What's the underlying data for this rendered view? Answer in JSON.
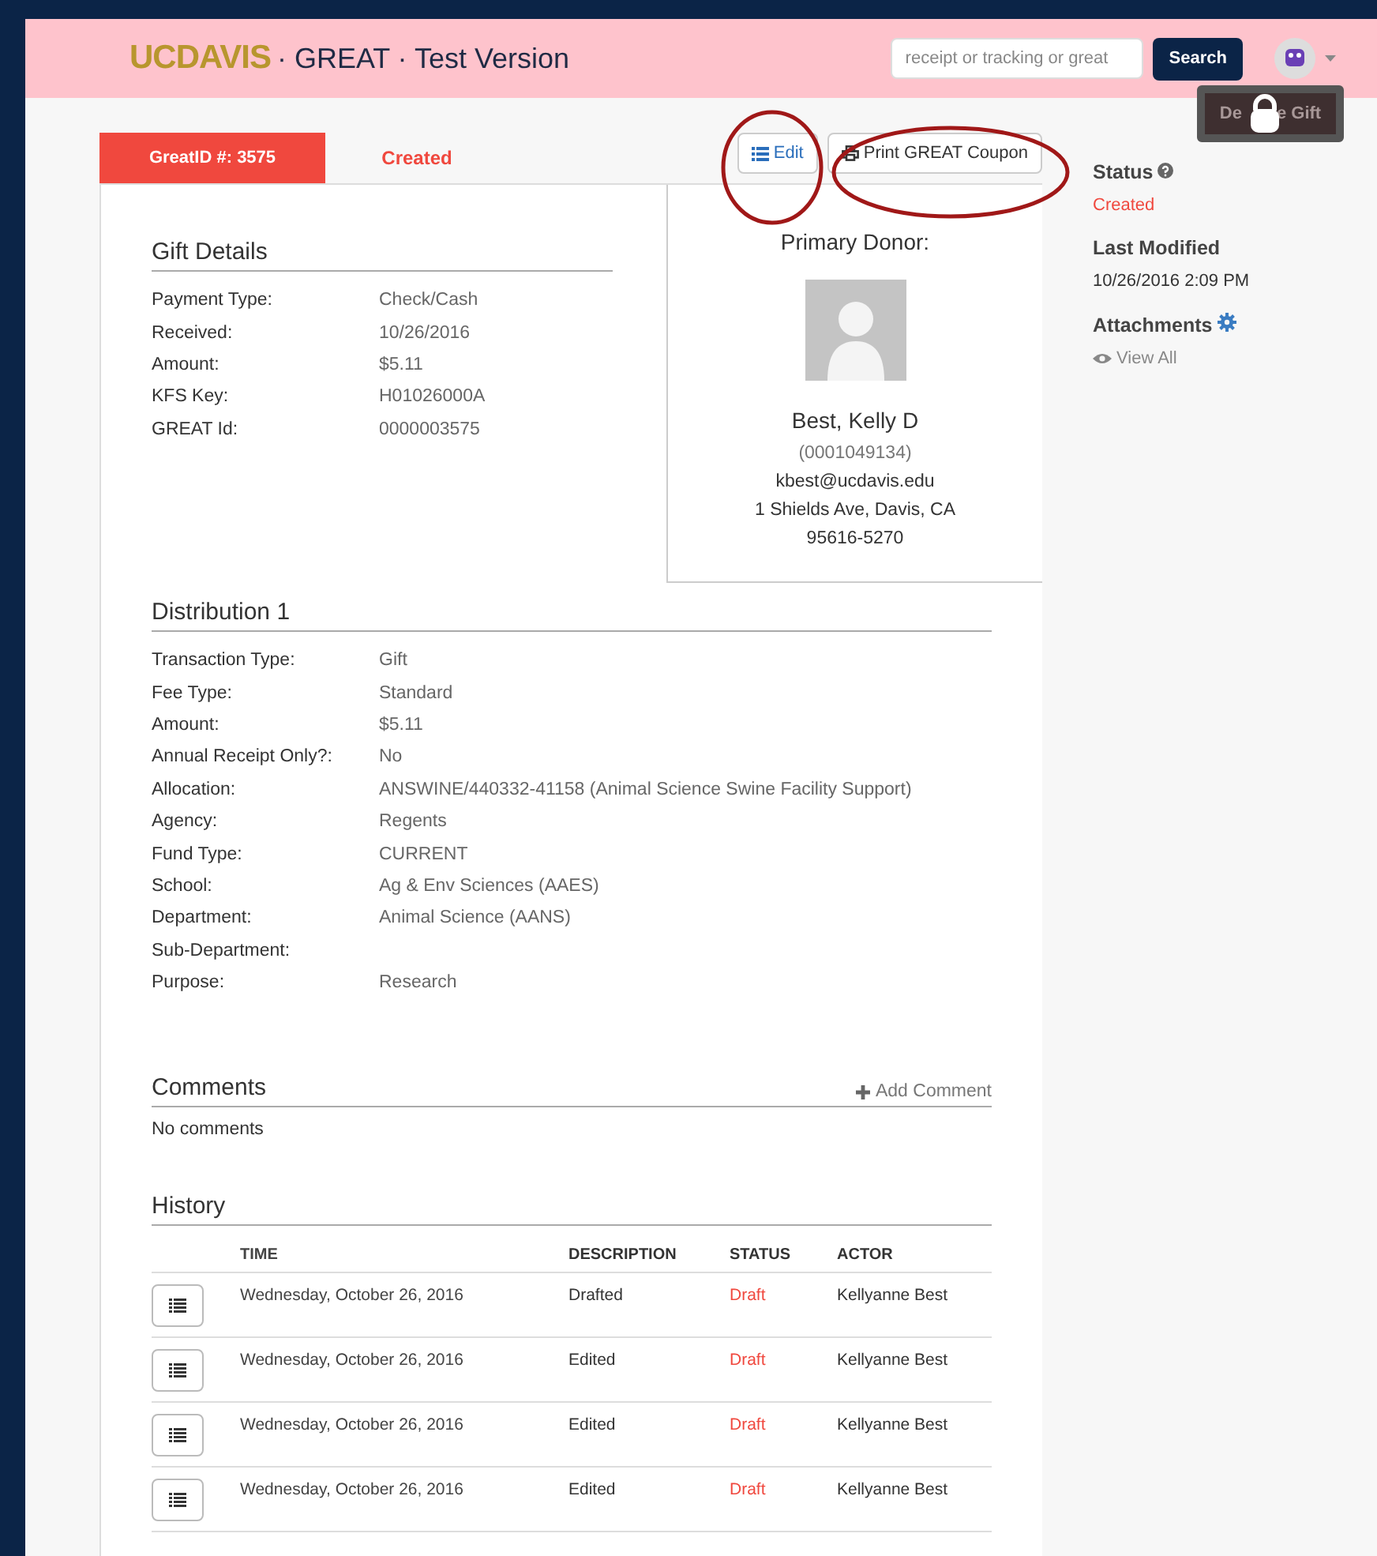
{
  "header": {
    "logo_uc": "UC",
    "logo_davis": "DAVIS",
    "title": "· GREAT · Test Version",
    "search": {
      "placeholder": "receipt or tracking or great"
    },
    "search_button": "Search"
  },
  "tabs": [
    {
      "label": "GreatID #: 3575",
      "selected": true
    },
    {
      "label": "Created",
      "selected": false
    }
  ],
  "actions": [
    {
      "kind": "edit",
      "label": "Edit"
    },
    {
      "kind": "print",
      "label": "Print GREAT Coupon"
    }
  ],
  "gift_details": {
    "title": "Gift Details",
    "fields": [
      {
        "label": "Payment Type:",
        "value": "Check/Cash"
      },
      {
        "label": "Received:",
        "value": "10/26/2016"
      },
      {
        "label": "Amount:",
        "value": "$5.11"
      },
      {
        "label": "KFS Key:",
        "value": "H01026000A"
      },
      {
        "label": "GREAT Id:",
        "value": "0000003575"
      }
    ]
  },
  "donor": {
    "title": "Primary Donor:",
    "name": "Best, Kelly D",
    "id": "(0001049134)",
    "email": "kbest@ucdavis.edu",
    "address": "1 Shields Ave, Davis, CA",
    "zip": "95616-5270"
  },
  "distribution": {
    "title": "Distribution 1",
    "fields": [
      {
        "label": "Transaction Type:",
        "value": "Gift"
      },
      {
        "label": "Fee Type:",
        "value": "Standard"
      },
      {
        "label": "Amount:",
        "value": "$5.11"
      },
      {
        "label": "Annual Receipt Only?:",
        "value": "No"
      },
      {
        "label": "Allocation:",
        "value": "ANSWINE/440332-41158 (Animal Science Swine Facility Support)"
      },
      {
        "label": "Agency:",
        "value": "Regents"
      },
      {
        "label": "Fund Type:",
        "value": "CURRENT"
      },
      {
        "label": "School:",
        "value": "Ag & Env Sciences (AAES)"
      },
      {
        "label": "Department:",
        "value": "Animal Science (AANS)"
      },
      {
        "label": "Sub-Department:"
      },
      {
        "label": "Purpose:",
        "value": "Research"
      }
    ]
  },
  "comments": {
    "title": "Comments",
    "add": "Add Comment",
    "empty": "No comments"
  },
  "history": {
    "title": "History",
    "columns": [
      "TIME",
      "DESCRIPTION",
      "STATUS",
      "ACTOR"
    ],
    "rows": [
      {
        "time": "Wednesday, October 26, 2016",
        "description": "Drafted",
        "status": "Draft",
        "actor": "Kellyanne Best"
      },
      {
        "time": "Wednesday, October 26, 2016",
        "description": "Edited",
        "status": "Draft",
        "actor": "Kellyanne Best"
      },
      {
        "time": "Wednesday, October 26, 2016",
        "description": "Edited",
        "status": "Draft",
        "actor": "Kellyanne Best"
      },
      {
        "time": "Wednesday, October 26, 2016",
        "description": "Edited",
        "status": "Draft",
        "actor": "Kellyanne Best"
      }
    ]
  },
  "delete_button": {
    "label_start": "De",
    "label_end": "e Gift",
    "disabled": true
  },
  "sidebar": {
    "status_label": "Status",
    "status": "Created",
    "modified_label": "Last Modified",
    "modified": "10/26/2016 2:09 PM",
    "attachments_label": "Attachments",
    "view_all": "View All"
  }
}
